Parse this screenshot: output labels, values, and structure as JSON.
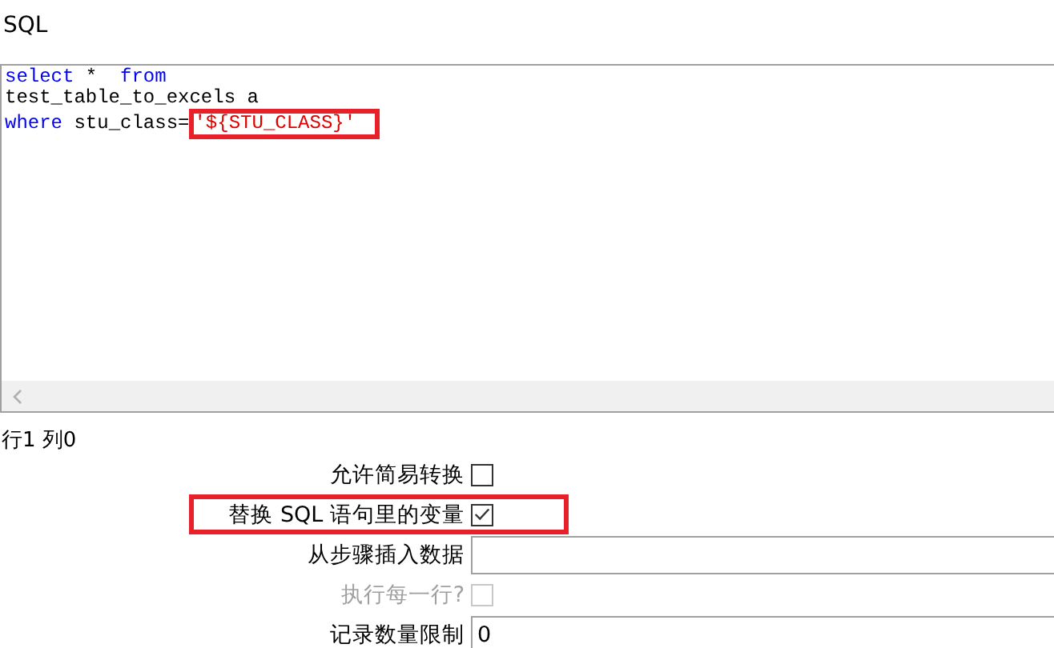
{
  "section_title": "SQL",
  "editor": {
    "lines": [
      [
        {
          "kind": "keyword",
          "text": "select"
        },
        {
          "kind": "plain",
          "text": " *  "
        },
        {
          "kind": "keyword",
          "text": "from"
        }
      ],
      [
        {
          "kind": "plain",
          "text": "test_table_to_excels a"
        }
      ],
      [
        {
          "kind": "keyword",
          "text": "where"
        },
        {
          "kind": "plain",
          "text": " stu_class="
        },
        {
          "kind": "string",
          "text": "'${STU_CLASS}'",
          "highlighted": true
        }
      ]
    ]
  },
  "status": "行1 列0",
  "options": [
    {
      "kind": "checkbox",
      "label": "允许简易转换",
      "checked": false,
      "disabled": false,
      "highlighted": false
    },
    {
      "kind": "checkbox",
      "label": "替换 SQL 语句里的变量",
      "checked": true,
      "disabled": false,
      "highlighted": true
    },
    {
      "kind": "field",
      "label": "从步骤插入数据",
      "highlighted": false
    },
    {
      "kind": "checkbox",
      "label": "执行每一行?",
      "checked": false,
      "disabled": true,
      "highlighted": false
    },
    {
      "kind": "field",
      "label": "记录数量限制",
      "value": "0",
      "highlighted": false
    }
  ]
}
